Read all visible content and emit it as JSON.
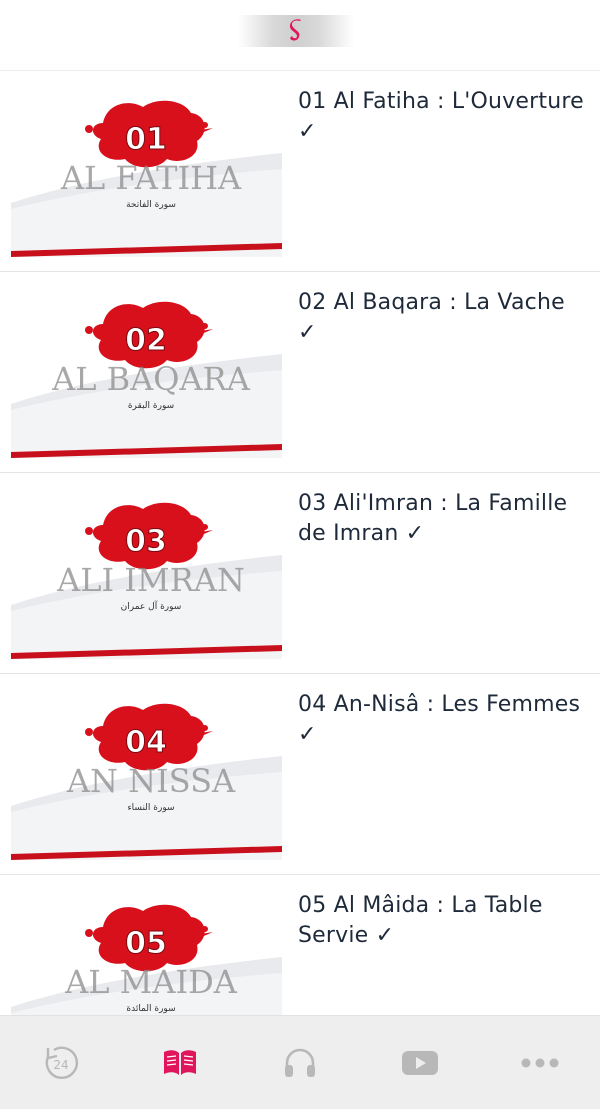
{
  "header": {
    "logo_icon": "brand-logo-icon"
  },
  "colors": {
    "accent": "#e0155b",
    "icon_inactive": "#b8b8b8",
    "thumb_red": "#d8101c",
    "tabbar_bg": "#eeeeee"
  },
  "surahs": [
    {
      "title": "01 Al Fatiha : L'Ouverture ✓",
      "thumb_number": "01",
      "thumb_name": "AL FATIHA",
      "thumb_arabic": "سورة الفاتحة"
    },
    {
      "title": "02 Al Baqara : La Vache ✓",
      "thumb_number": "02",
      "thumb_name": "AL BAQARA",
      "thumb_arabic": "سورة البقرة"
    },
    {
      "title": "03 Ali'Imran : La Famille de Imran ✓",
      "thumb_number": "03",
      "thumb_name": "ALI IMRAN",
      "thumb_arabic": "سورة آل عمران"
    },
    {
      "title": "04 An-Nisâ : Les Femmes ✓",
      "thumb_number": "04",
      "thumb_name": "AN NISSA",
      "thumb_arabic": "سورة النساء"
    },
    {
      "title": "05 Al Mâida : La Table Servie ✓",
      "thumb_number": "05",
      "thumb_name": "AL MAIDA",
      "thumb_arabic": "سورة المائدة"
    }
  ],
  "tabbar": {
    "replay_label": "24",
    "tabs": [
      {
        "icon": "replay-24-icon",
        "active": false
      },
      {
        "icon": "book-icon",
        "active": true
      },
      {
        "icon": "headphones-icon",
        "active": false
      },
      {
        "icon": "video-play-icon",
        "active": false
      },
      {
        "icon": "more-icon",
        "active": false
      }
    ]
  }
}
